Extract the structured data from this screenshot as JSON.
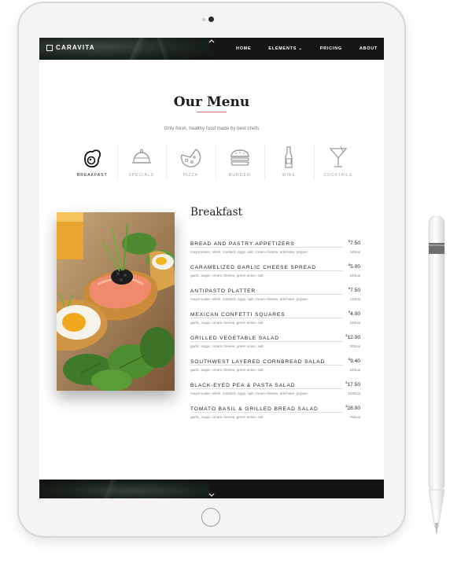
{
  "brand": {
    "name": "CARAVITA"
  },
  "nav": {
    "items": [
      {
        "label": "HOME"
      },
      {
        "label": "ELEMENTS ⌄"
      },
      {
        "label": "PRICING"
      },
      {
        "label": "ABOUT"
      }
    ]
  },
  "page": {
    "title": "Our Menu",
    "subtitle": "Only fresh, healthy food made by best chefs",
    "accent_color": "#e0676a"
  },
  "categories": [
    {
      "label": "BREAKFAST",
      "icon": "egg-icon",
      "active": true
    },
    {
      "label": "SPECIALS",
      "icon": "cloche-icon"
    },
    {
      "label": "PIZZA",
      "icon": "pizza-icon"
    },
    {
      "label": "BURGER",
      "icon": "burger-icon"
    },
    {
      "label": "WINE",
      "icon": "wine-bottle-icon"
    },
    {
      "label": "COCKTAILS",
      "icon": "cocktail-glass-icon"
    }
  ],
  "menu": {
    "heading": "Breakfast",
    "items": [
      {
        "name": "BREAD AND PASTRY APPETIZERS",
        "price": "7.50",
        "desc": "mayonnaise, relish, mustard, eggs, salt, cream cheese, artichoke, pepper",
        "cal": "345cal"
      },
      {
        "name": "CARAMELIZED GARLIC CHEESE SPREAD",
        "price": "5.00",
        "desc": "garlic, sugar, cream cheese, green onion, salt",
        "cal": "345cal"
      },
      {
        "name": "ANTIPASTO PLATTER",
        "price": "7.50",
        "desc": "mayonnaise, relish, mustard, eggs, salt, cream cheese, artichoke, pepper",
        "cal": "110cal"
      },
      {
        "name": "MEXICAN CONFETTI SQUARES",
        "price": "4.00",
        "desc": "garlic, sugar, cream cheese, green onion, salt",
        "cal": "345cal"
      },
      {
        "name": "GRILLED VEGETABLE SALAD",
        "price": "12.00",
        "desc": "garlic, sugar, cream cheese, green onion, salt",
        "cal": "300cal"
      },
      {
        "name": "SOUTHWEST LAYERED CORNBREAD SALAD",
        "price": "9.40",
        "desc": "garlic, sugar, cream cheese, green onion, salt",
        "cal": "345cal"
      },
      {
        "name": "BLACK-EYED PEA & PASTA SALAD",
        "price": "17.50",
        "desc": "mayonnaise, relish, mustard, eggs, salt, cream cheese, artichoke, pepper",
        "cal": "1035cal"
      },
      {
        "name": "TOMATO BASIL & GRILLED BREAD SALAD",
        "price": "28.00",
        "desc": "garlic, sugar, cream cheese, green onion, salt",
        "cal": "765cal"
      }
    ]
  }
}
